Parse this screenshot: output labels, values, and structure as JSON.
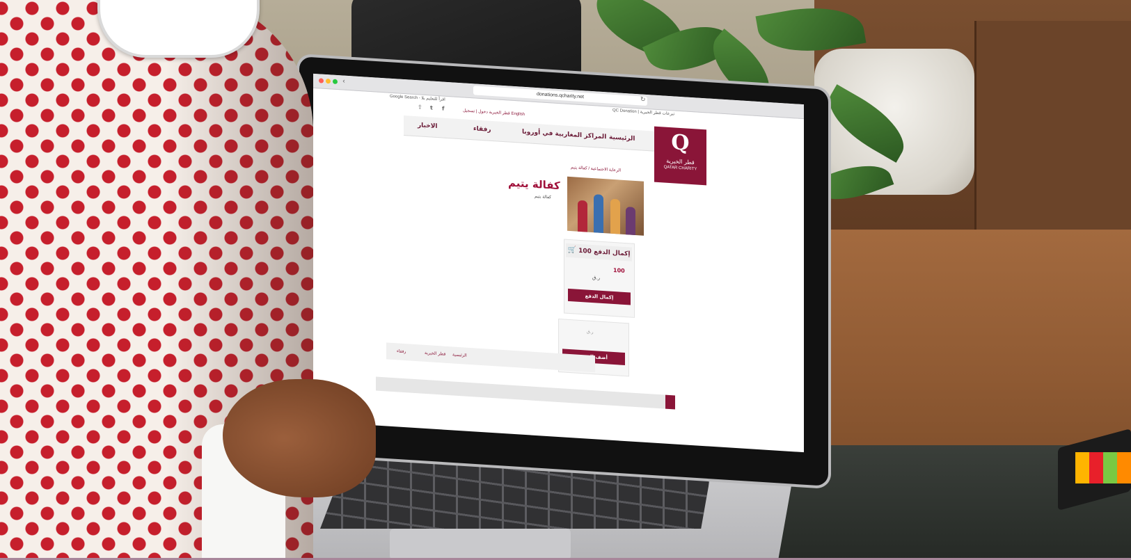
{
  "browser": {
    "url": "donations.qcharity.net",
    "tab_left": "Google Search - اقرأ للتعليم بلا",
    "tab_right": "QC Donation | تبرعات قطر الخيرية"
  },
  "site": {
    "top_links": "قطر الخيرية   دخول | تسجيل   English",
    "nav": {
      "home": "الرئيسية",
      "europe_centers": "المراكز المغاربية في أوروبا",
      "rofaqa": "رفقاء",
      "news": "الاخبار"
    },
    "logo": {
      "mark": "Q",
      "arabic": "قطر الخيرية",
      "english": "QATAR CHARITY"
    },
    "breadcrumb": "الرعاية الاجتماعية / كفالة يتيم",
    "product": {
      "title": "كفالة يتيم",
      "subtitle": "كفالة يتيم"
    },
    "payment": {
      "bar_label": "إكمال الدفع 100",
      "amount": "100",
      "currency": "ر.ق",
      "pay_button": "إكمال الدفع",
      "currency2": "ر.ق",
      "add_button": "أضف التبرع"
    },
    "footer": {
      "home": "الرئيسية",
      "org": "قطر الخيرية",
      "rofaqa": "رفقاء"
    }
  },
  "colors": {
    "brand": "#8a1538",
    "title": "#a0103a"
  },
  "icons": [
    "cart-icon",
    "share-icon",
    "twitter-icon",
    "facebook-icon",
    "reload-icon",
    "back-icon"
  ]
}
